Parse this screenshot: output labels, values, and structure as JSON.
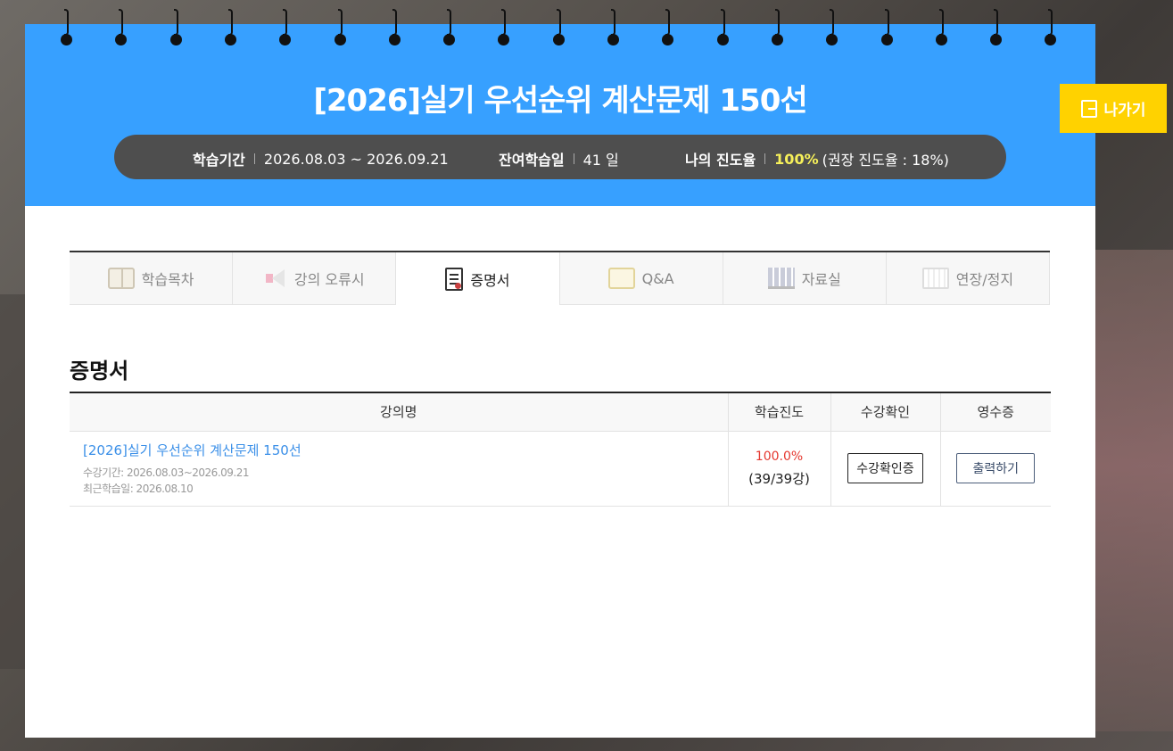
{
  "header": {
    "title": "[2026]실기 우선순위 계산문제 150선",
    "info": {
      "period_label": "학습기간",
      "period_value": "2026.08.03 ~ 2026.09.21",
      "remaining_label": "잔여학습일",
      "remaining_value": "41 일",
      "progress_label": "나의 진도율",
      "progress_value": "100%",
      "progress_recommend": "(권장 진도율 : 18%)"
    }
  },
  "exit_button": {
    "label": "나가기",
    "icon": "exit-icon"
  },
  "tabs": [
    {
      "label": "학습목차",
      "icon": "book-icon",
      "active": false
    },
    {
      "label": "강의 오류시",
      "icon": "speaker-icon",
      "active": false
    },
    {
      "label": "증명서",
      "icon": "document-icon",
      "active": true
    },
    {
      "label": "Q&A",
      "icon": "chat-icon",
      "active": false
    },
    {
      "label": "자료실",
      "icon": "books-icon",
      "active": false
    },
    {
      "label": "연장/정지",
      "icon": "calendar-icon",
      "active": false
    }
  ],
  "section": {
    "title": "증명서",
    "columns": [
      "강의명",
      "학습진도",
      "수강확인",
      "영수증"
    ],
    "rows": [
      {
        "course": "[2026]실기 우선순위 계산문제 150선",
        "period": "수강기간: 2026.08.03~2026.09.21",
        "last_study": "최근학습일: 2026.08.10",
        "progress_pct": "100.0%",
        "progress_count": "(39/39강)",
        "confirm_button": "수강확인증",
        "receipt_button": "출력하기"
      }
    ]
  },
  "colors": {
    "header_blue": "#37a0ff",
    "exit_yellow": "#ffd200",
    "link_blue": "#3a8fe8",
    "progress_red": "#e5382f"
  }
}
